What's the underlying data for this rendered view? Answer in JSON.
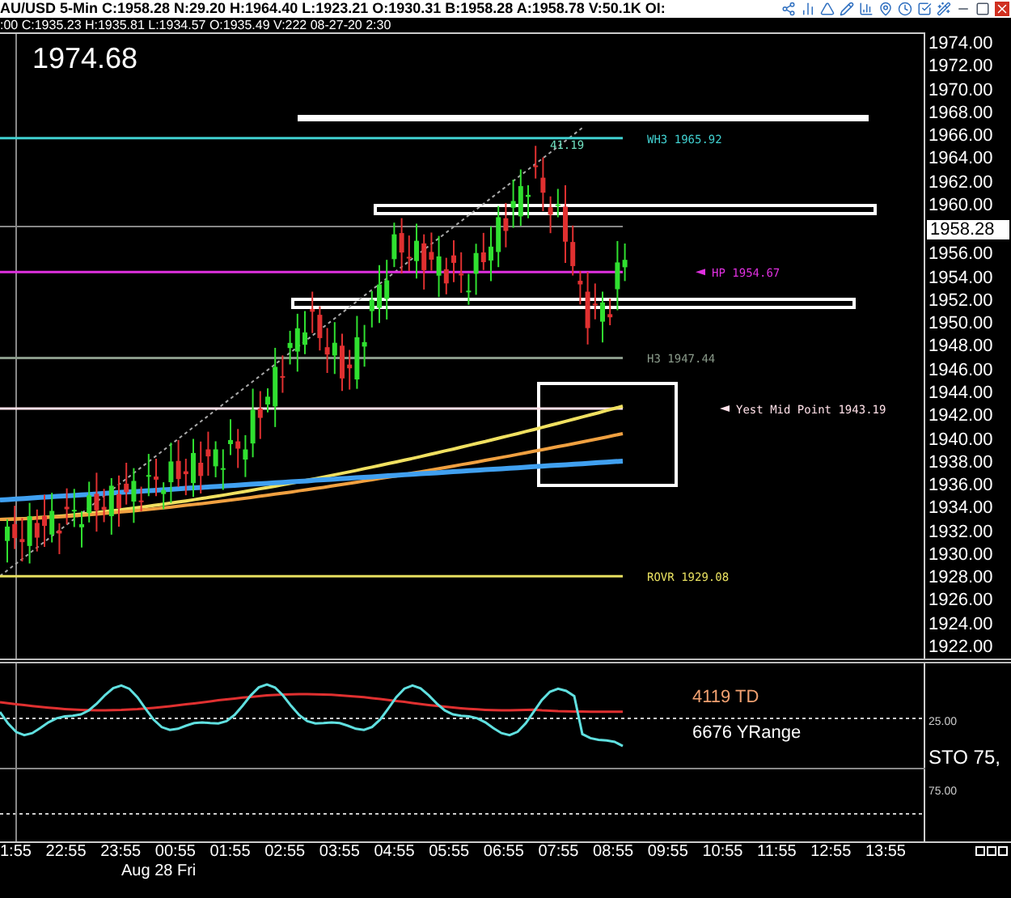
{
  "header": {
    "quote_line": "AU/USD 5-Min C:1958.28 N:29.20 H:1964.40 L:1923.21 O:1930.31 B:1958.28 A:1958.78 V:50.1K OI:"
  },
  "bar_info": ":00 C:1935.23 H:1935.81 L:1934.57 O:1935.49 V:222 08-27-20 2:30",
  "price_chart": {
    "last_price": "1974.68",
    "peak_label": "41.19",
    "levels": [
      {
        "label": "WH3 1965.92",
        "color": "#40d0d0",
        "kind": "line"
      },
      {
        "label": "HP 1954.67",
        "color": "#e030e0",
        "kind": "arrow"
      },
      {
        "label": "H3 1947.44",
        "color": "#8a9a8a",
        "kind": "line"
      },
      {
        "label": "Yest Mid Point 1943.19",
        "color": "#ffe0e8",
        "kind": "arrow"
      },
      {
        "label": "ROVR 1929.08",
        "color": "#e8e060",
        "kind": "line"
      }
    ],
    "price_axis": [
      {
        "text": "1974.00",
        "kind": "tick"
      },
      {
        "text": "1972.00",
        "kind": "tick"
      },
      {
        "text": "1970.00",
        "kind": "tick"
      },
      {
        "text": "1968.00",
        "kind": "tick"
      },
      {
        "text": "1966.00",
        "kind": "tick"
      },
      {
        "text": "1964.00",
        "kind": "tick"
      },
      {
        "text": "1962.00",
        "kind": "tick"
      },
      {
        "text": "1960.00",
        "kind": "tick"
      },
      {
        "text": "1958.28",
        "kind": "current"
      },
      {
        "text": "1956.00",
        "kind": "tick"
      },
      {
        "text": "1954.00",
        "kind": "tick"
      },
      {
        "text": "1952.00",
        "kind": "tick"
      },
      {
        "text": "1950.00",
        "kind": "tick"
      },
      {
        "text": "1948.00",
        "kind": "tick"
      },
      {
        "text": "1946.00",
        "kind": "tick"
      },
      {
        "text": "1944.00",
        "kind": "tick"
      },
      {
        "text": "1942.00",
        "kind": "tick"
      },
      {
        "text": "1940.00",
        "kind": "tick"
      },
      {
        "text": "1938.00",
        "kind": "tick"
      },
      {
        "text": "1936.00",
        "kind": "tick"
      },
      {
        "text": "1934.00",
        "kind": "tick"
      },
      {
        "text": "1932.00",
        "kind": "tick"
      },
      {
        "text": "1930.00",
        "kind": "tick"
      },
      {
        "text": "1928.00",
        "kind": "tick"
      },
      {
        "text": "1926.00",
        "kind": "tick"
      },
      {
        "text": "1924.00",
        "kind": "tick"
      },
      {
        "text": "1922.00",
        "kind": "tick"
      }
    ]
  },
  "indicator": {
    "labels": [
      {
        "text": "4119 TD",
        "color": "#f0a070"
      },
      {
        "text": "6676 YRange",
        "color": "#ffffff"
      }
    ],
    "axis": [
      {
        "text": "25.00",
        "kind": "small"
      },
      {
        "text": "STO 75,",
        "kind": "large"
      },
      {
        "text": "75.00",
        "kind": "small"
      }
    ]
  },
  "time_axis": {
    "times": [
      "1:55",
      "22:55",
      "23:55",
      "00:55",
      "01:55",
      "02:55",
      "03:55",
      "04:55",
      "05:55",
      "06:55",
      "07:55",
      "08:55",
      "09:55",
      "10:55",
      "11:55",
      "12:55",
      "13:55"
    ],
    "date": "Aug 28 Fri"
  }
}
